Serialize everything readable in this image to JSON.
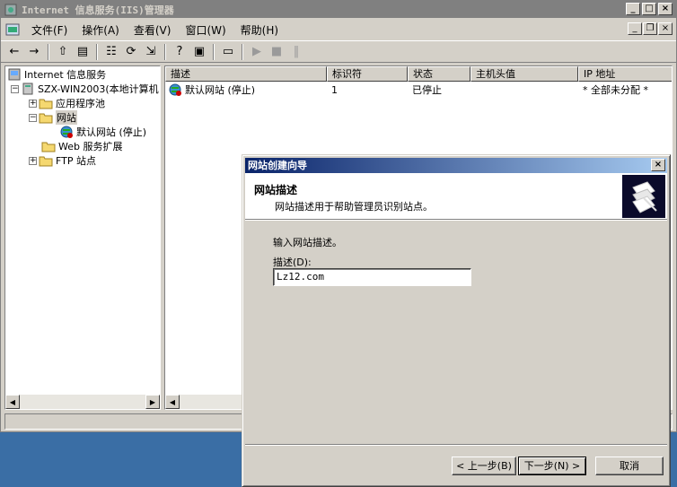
{
  "window": {
    "title": "Internet 信息服务(IIS)管理器",
    "caption_buttons": [
      "_",
      "□",
      "×"
    ]
  },
  "menu": {
    "items": [
      "文件(F)",
      "操作(A)",
      "查看(V)",
      "窗口(W)",
      "帮助(H)"
    ],
    "mdi_buttons": [
      "_",
      "❐",
      "×"
    ]
  },
  "toolbar": {
    "back": "←",
    "forward": "→",
    "up": "⇧",
    "show_tree": "▤",
    "properties": "☷",
    "refresh": "⟳",
    "export": "⇲",
    "help": "?",
    "console": "▣",
    "computer": "▭",
    "start": "▶",
    "stop": "■",
    "pause": "‖"
  },
  "tree": {
    "root": "Internet 信息服务",
    "server": "SZX-WIN2003(本地计算机",
    "app_pools": "应用程序池",
    "websites": "网站",
    "default_site": "默认网站 (停止)",
    "web_ext": "Web 服务扩展",
    "ftp": "FTP 站点"
  },
  "list": {
    "columns": [
      "描述",
      "标识符",
      "状态",
      "主机头值",
      "IP 地址"
    ],
    "rows": [
      {
        "desc": "默认网站 (停止)",
        "id": "1",
        "status": "已停止",
        "host": "",
        "ip": "* 全部未分配 *"
      }
    ]
  },
  "dialog": {
    "title": "网站创建向导",
    "header_title": "网站描述",
    "header_sub": "网站描述用于帮助管理员识别站点。",
    "prompt": "输入网站描述。",
    "field_label": "描述(D):",
    "field_value": "Lz12.com",
    "back": "< 上一步(B)",
    "next": "下一步(N) >",
    "cancel": "取消",
    "close": "×"
  },
  "colors": {
    "desktop": "#3a6ea5",
    "face": "#d4d0c8",
    "inactive_title": "#808080",
    "active_title_start": "#0a246a",
    "active_title_end": "#a6caf0"
  }
}
